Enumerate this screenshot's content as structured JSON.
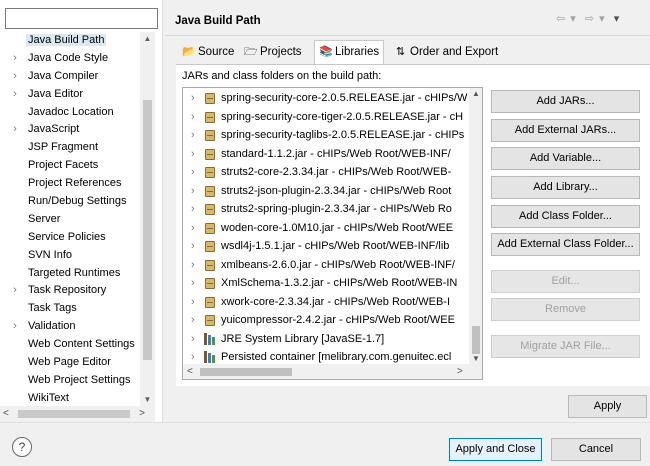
{
  "filter": {
    "value": ""
  },
  "sidebar": {
    "items": [
      {
        "label": "Java Build Path",
        "expandable": false,
        "selected": true
      },
      {
        "label": "Java Code Style",
        "expandable": true
      },
      {
        "label": "Java Compiler",
        "expandable": true
      },
      {
        "label": "Java Editor",
        "expandable": true
      },
      {
        "label": "Javadoc Location",
        "expandable": false
      },
      {
        "label": "JavaScript",
        "expandable": true
      },
      {
        "label": "JSP Fragment",
        "expandable": false
      },
      {
        "label": "Project Facets",
        "expandable": false
      },
      {
        "label": "Project References",
        "expandable": false
      },
      {
        "label": "Run/Debug Settings",
        "expandable": false
      },
      {
        "label": "Server",
        "expandable": false
      },
      {
        "label": "Service Policies",
        "expandable": false
      },
      {
        "label": "SVN Info",
        "expandable": false
      },
      {
        "label": "Targeted Runtimes",
        "expandable": false
      },
      {
        "label": "Task Repository",
        "expandable": true
      },
      {
        "label": "Task Tags",
        "expandable": false
      },
      {
        "label": "Validation",
        "expandable": true
      },
      {
        "label": "Web Content Settings",
        "expandable": false
      },
      {
        "label": "Web Page Editor",
        "expandable": false
      },
      {
        "label": "Web Project Settings",
        "expandable": false
      },
      {
        "label": "WikiText",
        "expandable": false
      }
    ]
  },
  "header": {
    "title": "Java Build Path",
    "nav_back": "⇦ ▾",
    "nav_forward": "⇨ ▾",
    "menu": "▾"
  },
  "tabs": [
    {
      "label": "Source",
      "icon": "source-folder-icon",
      "glyph": "📂",
      "active": false
    },
    {
      "label": "Projects",
      "icon": "projects-icon",
      "glyph": "🗁",
      "active": false
    },
    {
      "label": "Libraries",
      "icon": "libraries-icon",
      "glyph": "📚",
      "active": true
    },
    {
      "label": "Order and Export",
      "icon": "order-export-icon",
      "glyph": "⇅",
      "active": false
    }
  ],
  "panel": {
    "caption": "JARs and class folders on the build path:",
    "entries": [
      {
        "text": "spring-security-core-2.0.5.RELEASE.jar - cHIPs/W",
        "kind": "jar"
      },
      {
        "text": "spring-security-core-tiger-2.0.5.RELEASE.jar - cH",
        "kind": "jar"
      },
      {
        "text": "spring-security-taglibs-2.0.5.RELEASE.jar - cHIPs",
        "kind": "jar"
      },
      {
        "text": "standard-1.1.2.jar - cHIPs/Web Root/WEB-INF/",
        "kind": "jar"
      },
      {
        "text": "struts2-core-2.3.34.jar - cHIPs/Web Root/WEB-",
        "kind": "jar"
      },
      {
        "text": "struts2-json-plugin-2.3.34.jar - cHIPs/Web Root",
        "kind": "jar"
      },
      {
        "text": "struts2-spring-plugin-2.3.34.jar - cHIPs/Web Ro",
        "kind": "jar"
      },
      {
        "text": "woden-core-1.0M10.jar - cHIPs/Web Root/WEE",
        "kind": "jar"
      },
      {
        "text": "wsdl4j-1.5.1.jar - cHIPs/Web Root/WEB-INF/lib",
        "kind": "jar"
      },
      {
        "text": "xmlbeans-2.6.0.jar - cHIPs/Web Root/WEB-INF/",
        "kind": "jar"
      },
      {
        "text": "XmlSchema-1.3.2.jar - cHIPs/Web Root/WEB-IN",
        "kind": "jar"
      },
      {
        "text": "xwork-core-2.3.34.jar - cHIPs/Web Root/WEB-I",
        "kind": "jar"
      },
      {
        "text": "yuicompressor-2.4.2.jar - cHIPs/Web Root/WEE",
        "kind": "jar"
      },
      {
        "text": "JRE System Library [JavaSE-1.7]",
        "kind": "library"
      },
      {
        "text": "Persisted container [melibrary.com.genuitec.ecl",
        "kind": "library"
      }
    ]
  },
  "buttons": {
    "add_jars": "Add JARs...",
    "add_external_jars": "Add External JARs...",
    "add_variable": "Add Variable...",
    "add_library": "Add Library...",
    "add_class_folder": "Add Class Folder...",
    "add_external_class_folder": "Add External Class Folder...",
    "edit": "Edit...",
    "remove": "Remove",
    "migrate_jar": "Migrate JAR File...",
    "apply": "Apply",
    "apply_and_close": "Apply and Close",
    "cancel": "Cancel",
    "help": "?"
  },
  "colors": {
    "selection": "#dde8f5",
    "default_button_border": "#0078d7",
    "disabled_text": "#a0a0a0"
  }
}
